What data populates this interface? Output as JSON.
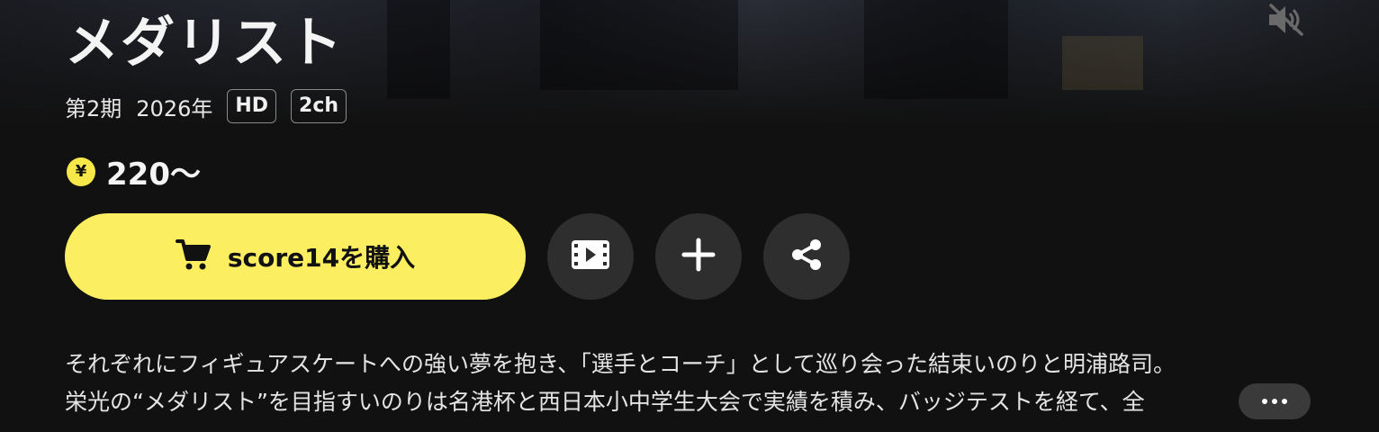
{
  "title": "メダリスト",
  "meta": {
    "season": "第2期",
    "year": "2026年",
    "badges": [
      "HD",
      "2ch"
    ]
  },
  "price": {
    "currency_symbol": "¥",
    "amount": "220〜"
  },
  "actions": {
    "buy_label": "score14を購入",
    "trailer_icon": "film-icon",
    "add_icon": "plus-icon",
    "share_icon": "share-icon",
    "mute_icon": "speaker-muted-icon"
  },
  "description": {
    "line1": "それぞれにフィギュアスケートへの強い夢を抱き、「選手とコーチ」として巡り会った結束いのりと明浦路司。",
    "line2": "栄光の“メダリスト”を目指すいのりは名港杯と西日本小中学生大会で実績を積み、バッジテストを経て、全"
  },
  "colors": {
    "accent": "#fbee60",
    "background": "#111111",
    "circle_button": "#2e2e2e"
  }
}
